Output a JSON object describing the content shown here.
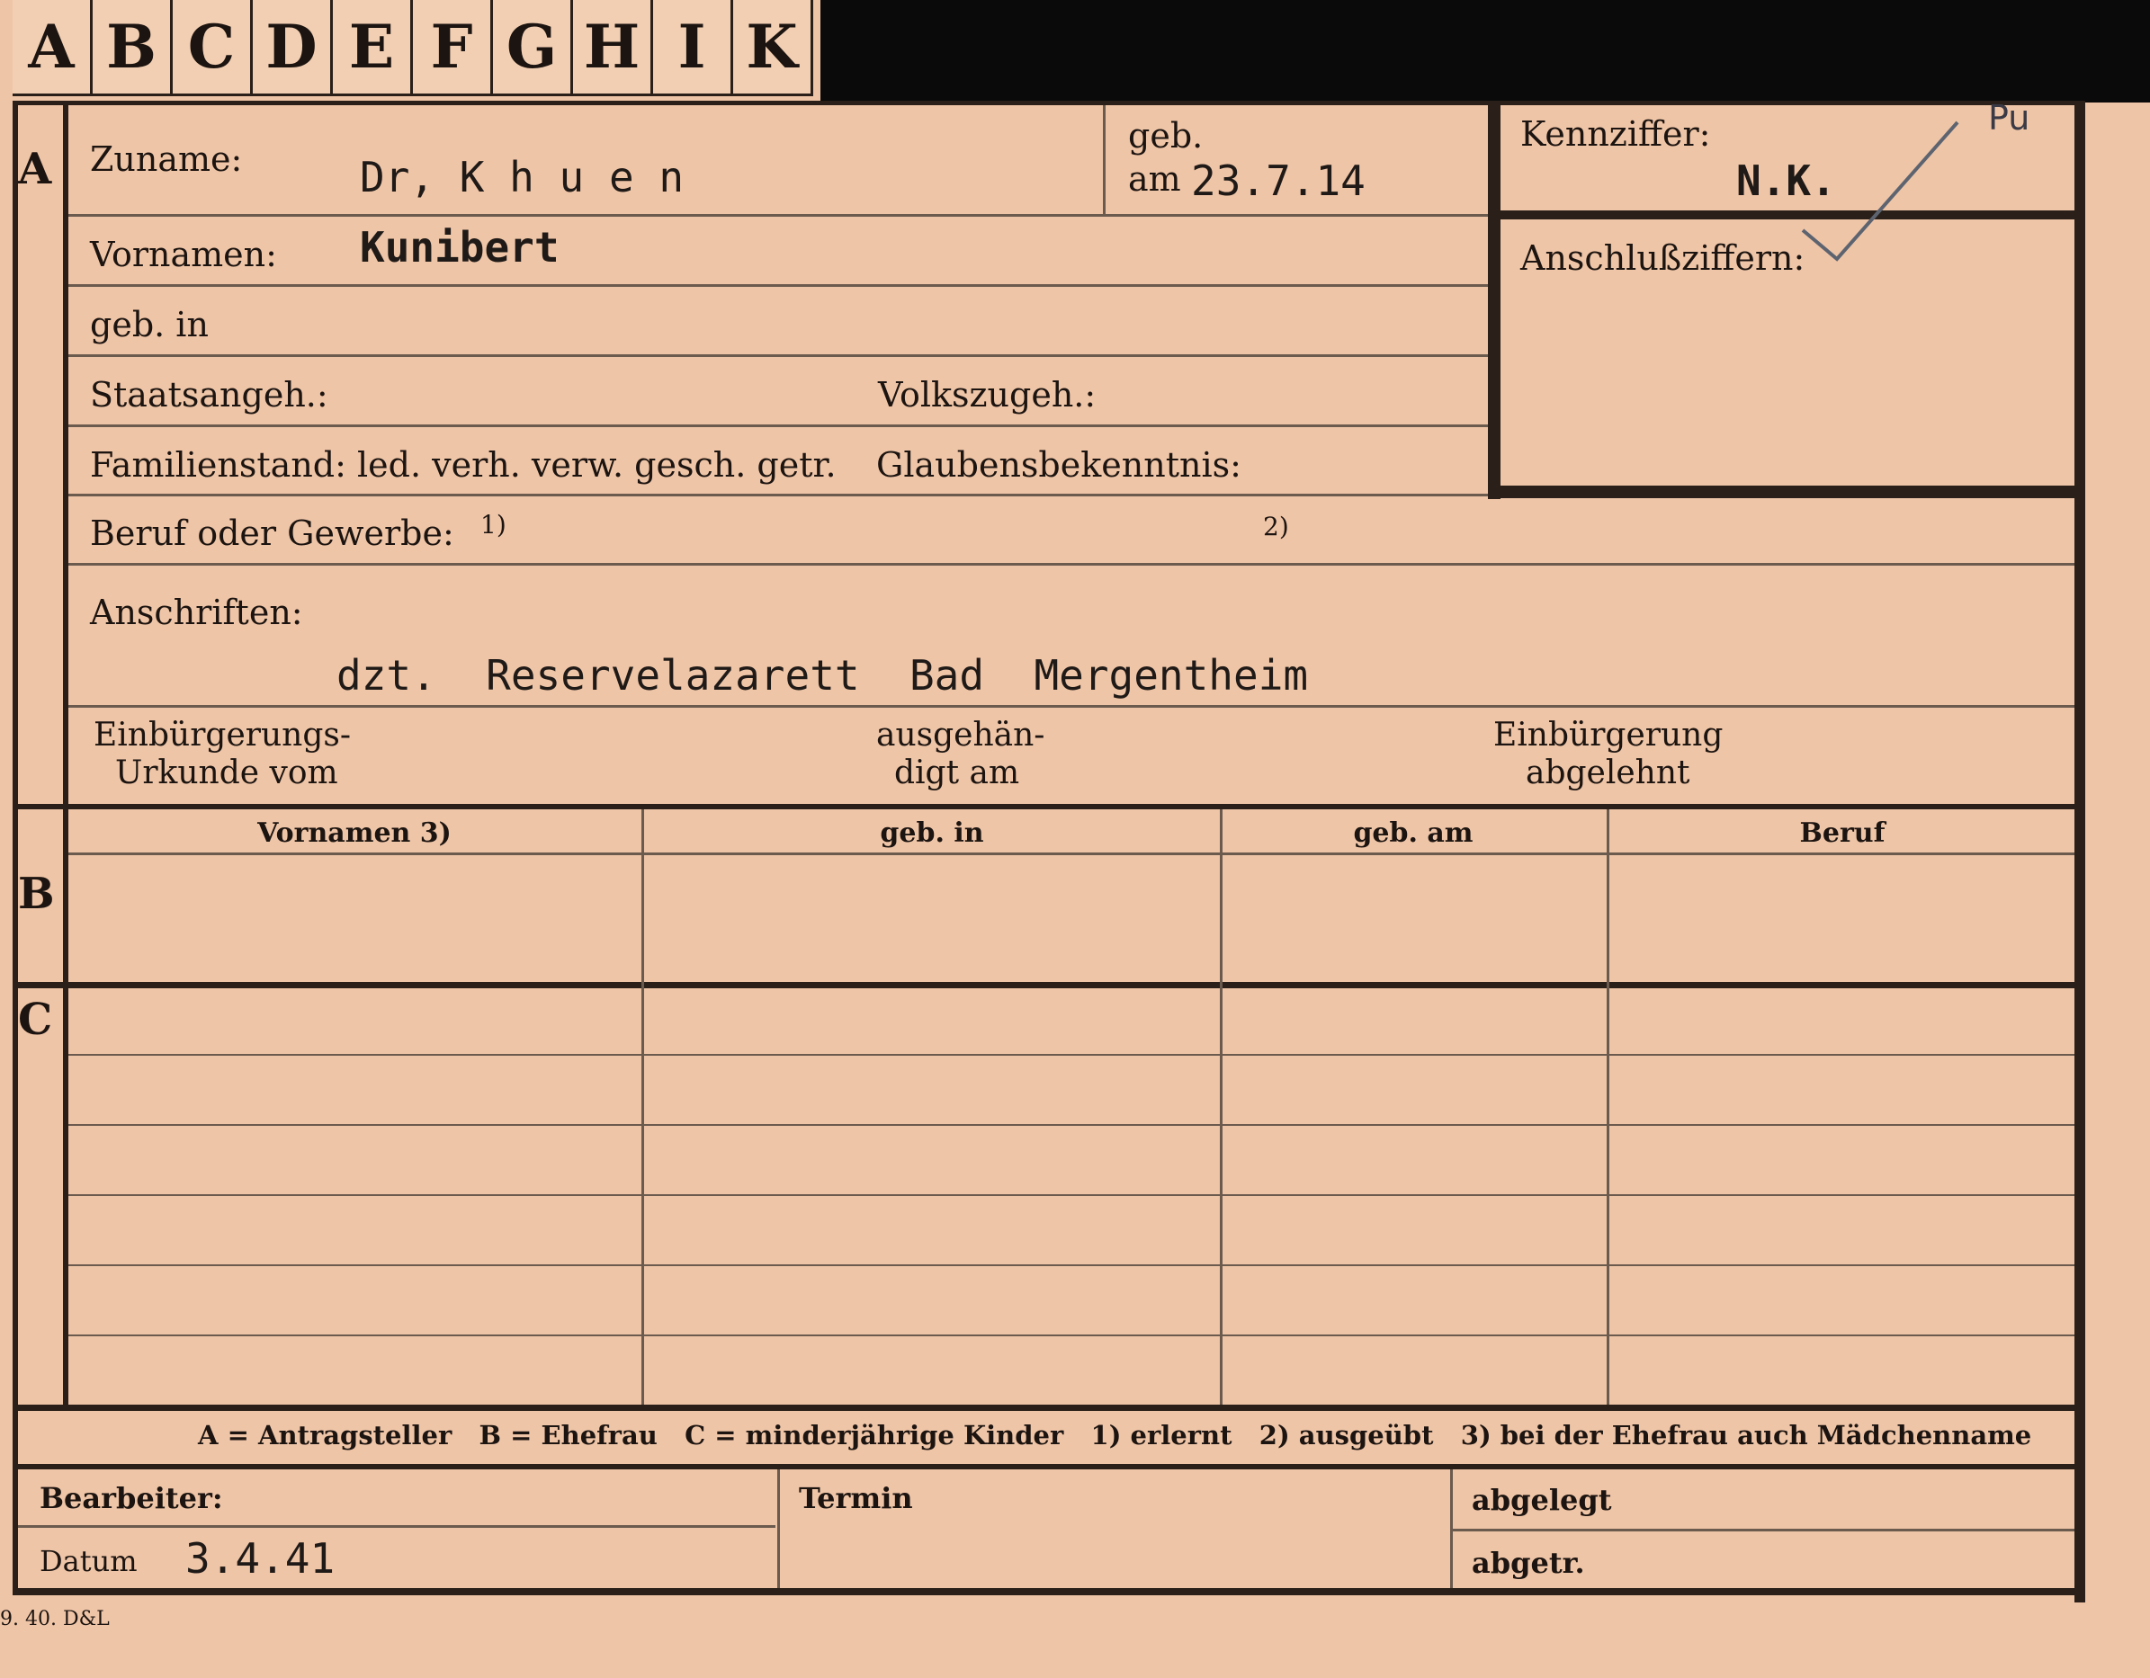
{
  "tabs": [
    "A",
    "B",
    "C",
    "D",
    "E",
    "F",
    "G",
    "H",
    "I",
    "K"
  ],
  "section_a": {
    "marker": "A",
    "zuname_label": "Zuname:",
    "zuname_value": "Dr, K h u e n",
    "geb_label": "geb.",
    "am_label": "am",
    "birth_date": "23.7.14",
    "vornamen_label": "Vornamen:",
    "vornamen_value": "Kunibert",
    "geb_in_label": "geb. in",
    "staatsangeh_label": "Staatsangeh.:",
    "volkszugeh_label": "Volkszugeh.:",
    "familienstand_label": "Familienstand: led. verh. verw. gesch. getr.",
    "glaubens_label": "Glaubensbekenntnis:",
    "beruf_label": "Beruf oder Gewerbe:",
    "beruf_note1": "1)",
    "beruf_note2": "2)",
    "anschriften_label": "Anschriften:",
    "address_value": "dzt.  Reservelazarett  Bad  Mergentheim",
    "einbuergerung_line1": "Einbürgerungs-",
    "einbuergerung_line2": "Urkunde vom",
    "ausgehaen_line1": "ausgehän-",
    "ausgehaen_line2": "digt am",
    "abgelehnt_line1": "Einbürgerung",
    "abgelehnt_line2": "abgelehnt"
  },
  "kennziffer": {
    "label": "Kennziffer:",
    "value": "N.K.",
    "corner_mark": "Pu",
    "anschluss_label": "Anschlußziffern:"
  },
  "section_b": {
    "marker": "B",
    "columns": [
      "Vornamen 3)",
      "geb. in",
      "geb. am",
      "Beruf"
    ]
  },
  "section_c": {
    "marker": "C"
  },
  "legend": "A = Antragsteller   B = Ehefrau   C = minderjährige Kinder   1) erlernt   2) ausgeübt   3) bei der Ehefrau auch Mädchenname",
  "footer": {
    "bearbeiter_label": "Bearbeiter:",
    "datum_label": "Datum",
    "datum_value": "3.4.41",
    "termin_label": "Termin",
    "abgelegt_label": "abgelegt",
    "abgetr_label": "abgetr.",
    "print_code": "9. 40. D&L"
  }
}
